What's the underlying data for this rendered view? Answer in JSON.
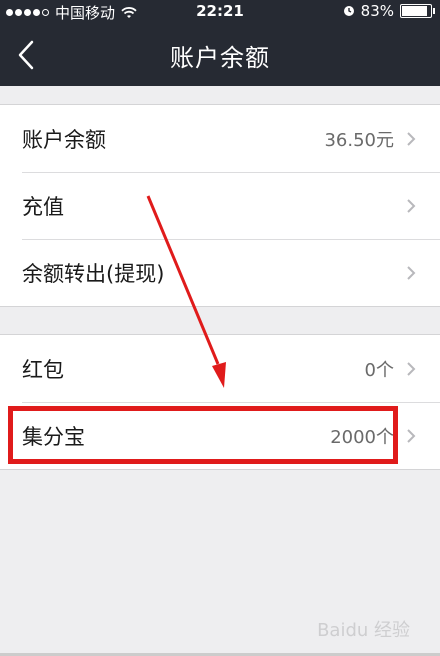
{
  "status_bar": {
    "carrier": "中国移动",
    "time": "22:21",
    "battery": "83%",
    "battery_level": 0.83
  },
  "nav": {
    "title": "账户余额"
  },
  "group1": {
    "rows": [
      {
        "label": "账户余额",
        "value": "36.50元"
      },
      {
        "label": "充值",
        "value": ""
      },
      {
        "label": "余额转出(提现)",
        "value": ""
      }
    ]
  },
  "group2": {
    "rows": [
      {
        "label": "红包",
        "value": "0个"
      },
      {
        "label": "集分宝",
        "value": "2000个"
      }
    ]
  },
  "annotation": {
    "highlight_color": "#e01b1b"
  },
  "watermark": {
    "text": "Baidu 经验"
  }
}
